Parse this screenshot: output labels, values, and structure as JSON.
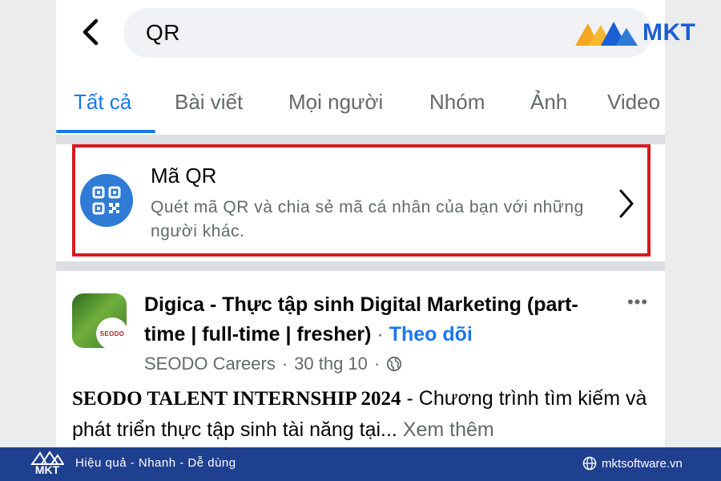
{
  "search": {
    "query": "QR"
  },
  "tabs": [
    {
      "label": "Tất cả",
      "active": true
    },
    {
      "label": "Bài viết",
      "active": false
    },
    {
      "label": "Mọi người",
      "active": false
    },
    {
      "label": "Nhóm",
      "active": false
    },
    {
      "label": "Ảnh",
      "active": false
    },
    {
      "label": "Video",
      "active": false
    }
  ],
  "qr_card": {
    "title": "Mã QR",
    "description": "Quét mã QR và chia sẻ mã cá nhân của bạn với những người khác.",
    "icon": "qr-code-icon",
    "highlight_color": "#d71920"
  },
  "post": {
    "avatar_text": "SEODO",
    "title": "Digica - Thực tập sinh Digital Marketing (part-time | full-time | fresher)",
    "separator": " · ",
    "follow_label": "Theo dõi",
    "author": "SEODO Careers",
    "date": "30 thg 10",
    "meta_separator": "·",
    "privacy_icon": "globe-icon",
    "body_bold": "SEODO TALENT INTERNSHIP 2024",
    "body_text": " - Chương trình tìm kiếm và phát triển thực tập sinh tài năng tại...",
    "see_more": "Xem thêm",
    "more_label": "•••"
  },
  "brand": {
    "name": "MKT"
  },
  "footer": {
    "logo_text": "MKT",
    "slogan": "Hiệu quả - Nhanh - Dễ dùng",
    "website": "mktsoftware.vn"
  },
  "colors": {
    "accent": "#1877f2",
    "footer_bg": "#1f3f8f",
    "brand_blue": "#1a5fd6",
    "brand_orange": "#f5a623"
  }
}
